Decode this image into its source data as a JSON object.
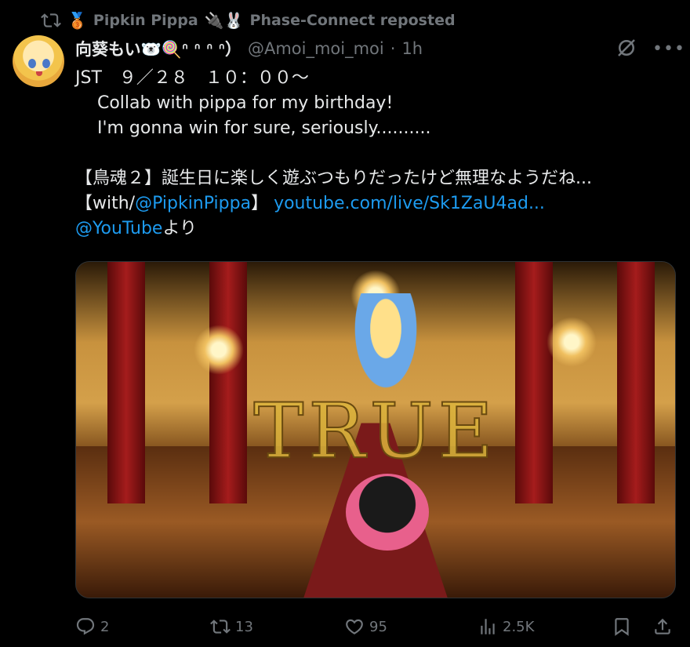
{
  "repost": {
    "reposters_text": "Pipkin Pippa 🔌🐰 Phase-Connect reposted",
    "medal_emoji": "🥉",
    "name1": "Pipkin Pippa",
    "emoji2": "🔌🐰",
    "name2": "Phase-Connect reposted"
  },
  "tweet": {
    "author_name": "向葵もい🐻‍❄️🍭ᐢ ᐢ ᐢ ᐢ）",
    "handle": "@Amoi_moi_moi",
    "separator": "·",
    "time": "1h",
    "text_line1": "JST　９／２８　１０：００〜",
    "text_line2": "    Collab with pippa for my birthday!",
    "text_line3": "    I'm gonna win for sure, seriously..........",
    "text_line4": "",
    "text_line5": "【鳥魂２】誕生日に楽しく遊ぶつもりだったけど無理なようだね...",
    "text_line6_prefix": "【with/",
    "mention_pippa": "@PipkinPippa",
    "text_line6_mid": "】 ",
    "link_youtube": "youtube.com/live/Sk1ZaU4ad...",
    "mention_youtube": "@YouTube",
    "text_line7_suffix": "より",
    "media_overlay_text": "TRUE"
  },
  "actions": {
    "replies": "2",
    "reposts": "13",
    "likes": "95",
    "views": "2.5K"
  },
  "colors": {
    "background": "#000000",
    "text": "#e7e9ea",
    "muted": "#71767b",
    "link": "#1d9bf0"
  },
  "icons": [
    "repost-icon",
    "grok-icon",
    "more-icon",
    "reply-icon",
    "retweet-icon",
    "like-icon",
    "views-icon",
    "bookmark-icon",
    "share-icon"
  ]
}
